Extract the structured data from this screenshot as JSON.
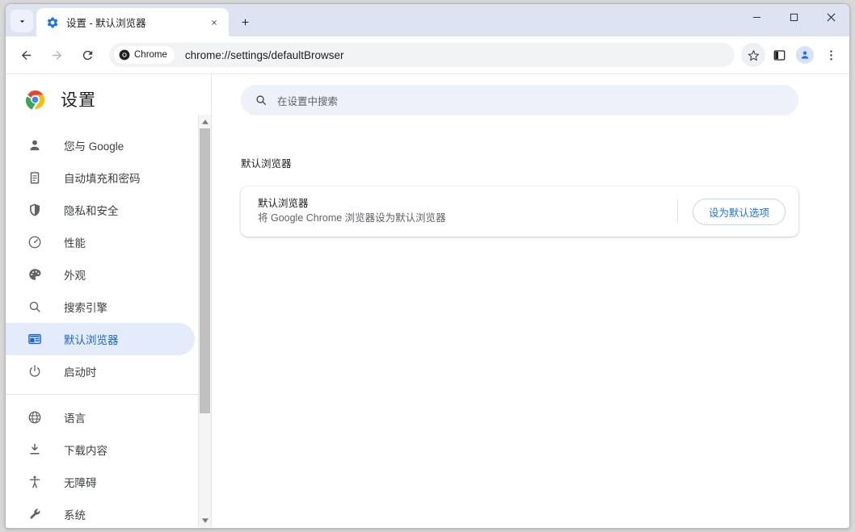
{
  "window": {
    "controls": {
      "minimize": "–",
      "maximize": "□",
      "close": "✕"
    }
  },
  "tabstrip": {
    "tab_search_label": "搜索标签页",
    "new_tab_label": "新建标签页",
    "tabs": [
      {
        "title": "设置 - 默认浏览器",
        "favicon": "gear-icon",
        "close_label": "关闭"
      }
    ]
  },
  "toolbar": {
    "back_label": "返回",
    "forward_label": "前进",
    "reload_label": "重新加载",
    "chip_label": "Chrome",
    "url": "chrome://settings/defaultBrowser",
    "bookmark_label": "为此标签页添加书签",
    "side_panel_label": "显示侧边栏",
    "profile_label": "个人资料",
    "menu_label": "自定义及控制 Google Chrome"
  },
  "settings": {
    "title": "设置",
    "logo": "chrome-logo",
    "search": {
      "placeholder": "在设置中搜索",
      "value": "",
      "icon": "search-icon"
    },
    "sidebar": {
      "group1": [
        {
          "label": "您与 Google",
          "icon": "person-icon",
          "selected": false
        },
        {
          "label": "自动填充和密码",
          "icon": "clipboard-icon",
          "selected": false
        },
        {
          "label": "隐私和安全",
          "icon": "shield-icon",
          "selected": false
        },
        {
          "label": "性能",
          "icon": "speedometer-icon",
          "selected": false
        },
        {
          "label": "外观",
          "icon": "palette-icon",
          "selected": false
        },
        {
          "label": "搜索引擎",
          "icon": "search-icon",
          "selected": false
        },
        {
          "label": "默认浏览器",
          "icon": "browser-window-icon",
          "selected": true
        },
        {
          "label": "启动时",
          "icon": "power-icon",
          "selected": false
        }
      ],
      "group2": [
        {
          "label": "语言",
          "icon": "globe-icon",
          "selected": false
        },
        {
          "label": "下载内容",
          "icon": "download-icon",
          "selected": false
        },
        {
          "label": "无障碍",
          "icon": "accessibility-icon",
          "selected": false
        },
        {
          "label": "系统",
          "icon": "wrench-icon",
          "selected": false
        }
      ]
    },
    "main": {
      "section_title": "默认浏览器",
      "card": {
        "title": "默认浏览器",
        "description": "将 Google Chrome 浏览器设为默认浏览器",
        "button_label": "设为默认选项"
      }
    }
  },
  "colors": {
    "accent_blue": "#1a73e8",
    "selected_nav_bg": "#e4ebfa",
    "selected_nav_text": "#1b66c9",
    "tabstrip_bg": "#dde3f0",
    "search_bg": "#eef1f9"
  }
}
